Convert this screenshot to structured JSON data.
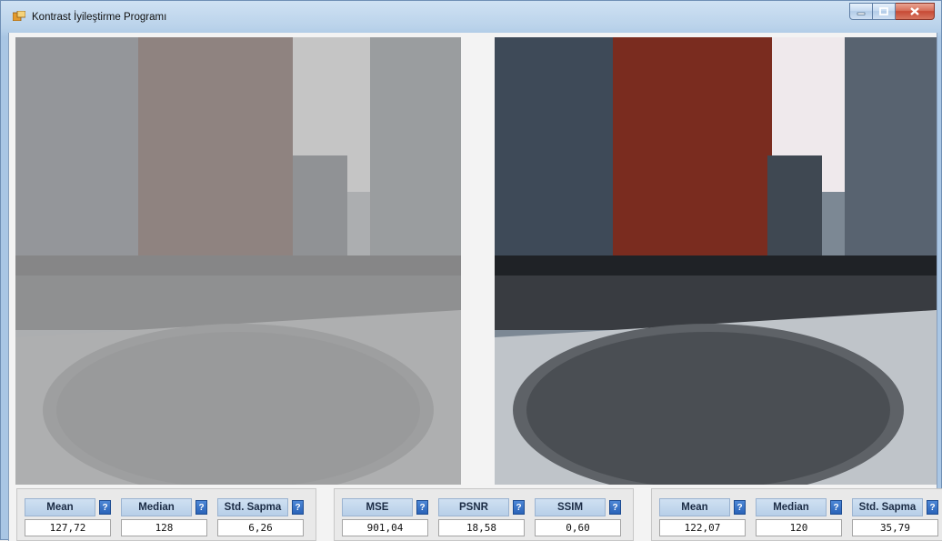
{
  "window": {
    "title": "Kontrast İyileştirme Programı",
    "icon": "app-window-icon",
    "controls": [
      "minimize-icon",
      "maximize-icon",
      "close-icon"
    ]
  },
  "images": {
    "left": {
      "description_role": "low-contrast input image"
    },
    "right": {
      "description_role": "contrast-enhanced output image"
    }
  },
  "stats": {
    "input": {
      "mean_label": "Mean",
      "mean_value": "127,72",
      "median_label": "Median",
      "median_value": "128",
      "std_label": "Std. Sapma",
      "std_value": "6,26"
    },
    "quality": {
      "mse_label": "MSE",
      "mse_value": "901,04",
      "psnr_label": "PSNR",
      "psnr_value": "18,58",
      "ssim_label": "SSIM",
      "ssim_value": "0,60"
    },
    "output": {
      "mean_label": "Mean",
      "mean_value": "122,07",
      "median_label": "Median",
      "median_value": "120",
      "std_label": "Std. Sapma",
      "std_value": "35,79"
    },
    "help_glyph": "?"
  },
  "colors": {
    "title_bar": "#b9d2ea",
    "help_button": "#2a63b8",
    "close_button": "#c74a35"
  }
}
